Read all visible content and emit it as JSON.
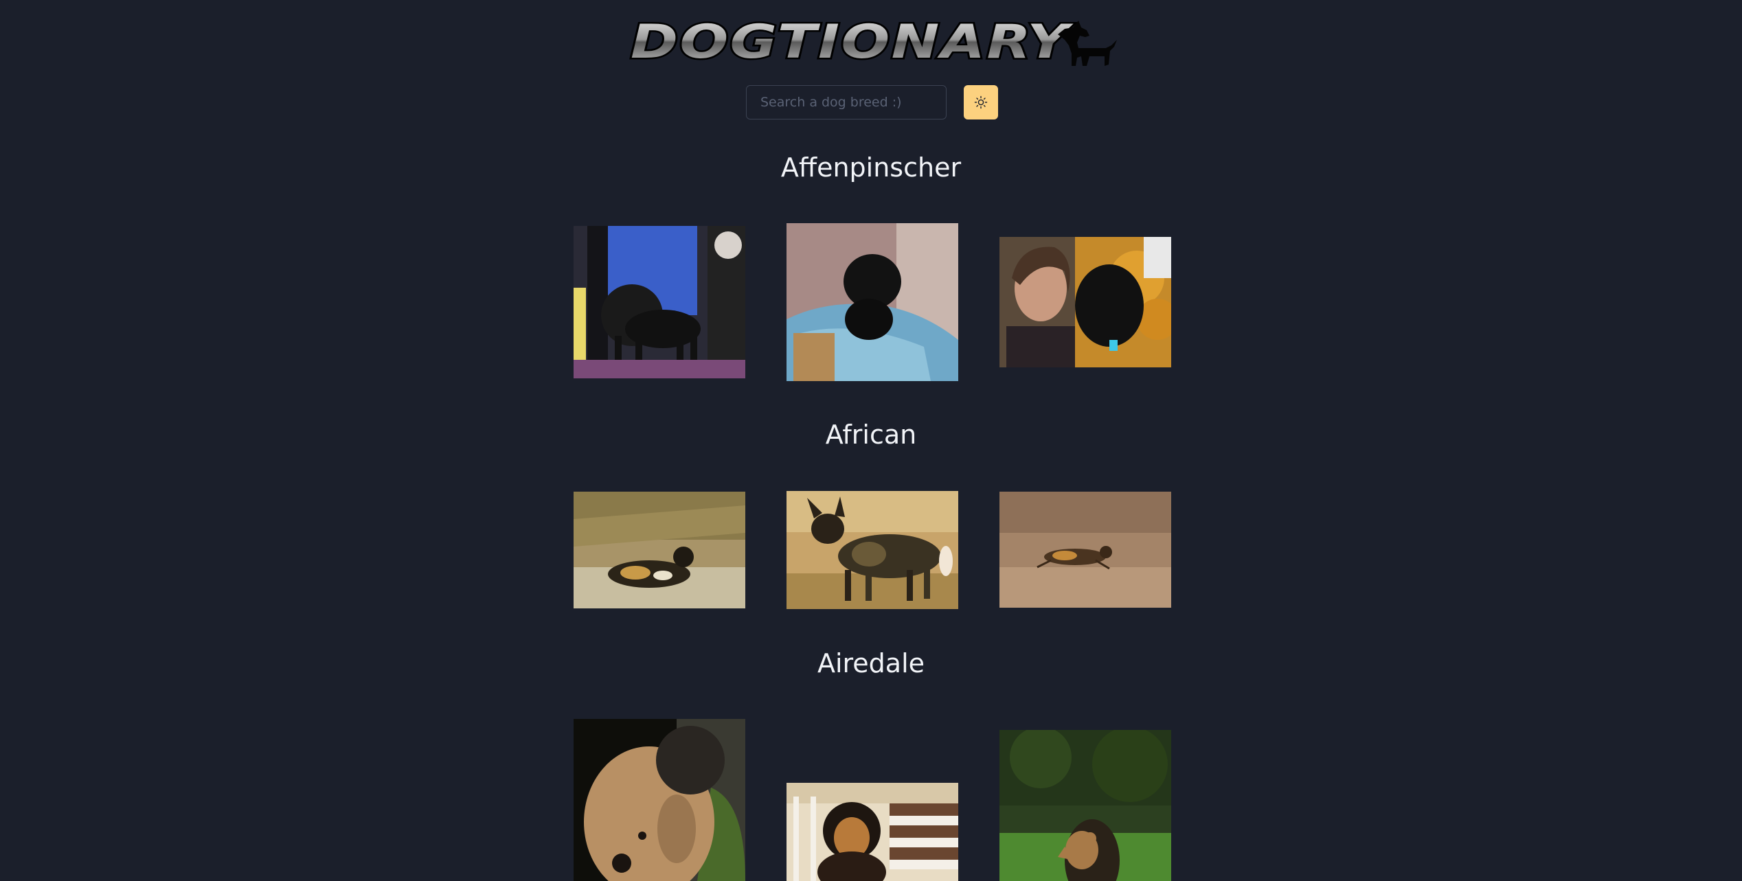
{
  "app": {
    "logo_text": "DOGTIONARY"
  },
  "search": {
    "placeholder": "Search a dog breed :)",
    "value": ""
  },
  "theme_toggle": {
    "icon": "sun-icon",
    "color": "#fcd17f"
  },
  "colors": {
    "background": "#1b1f2b",
    "accent": "#fcd17f",
    "title_text": "#f2f4f8"
  },
  "breeds": [
    {
      "name": "Affenpinscher",
      "photos": [
        {
          "subject": "black affenpinscher on show table with handler in blue jacket"
        },
        {
          "subject": "black affenpinscher puppy on blue blanket in wicker basket"
        },
        {
          "subject": "woman posing with black affenpinscher in front of orange flowers"
        }
      ]
    },
    {
      "name": "African",
      "photos": [
        {
          "subject": "african wild dog lying in grass"
        },
        {
          "subject": "african wild dog standing in savanna grass"
        },
        {
          "subject": "african wild dog running across plain"
        }
      ]
    },
    {
      "name": "Airedale",
      "photos": [
        {
          "subject": "close-up of curly airedale terrier face"
        },
        {
          "subject": "airedale puppy sitting on stairs"
        },
        {
          "subject": "airedale terrier standing on green lawn"
        }
      ]
    }
  ]
}
